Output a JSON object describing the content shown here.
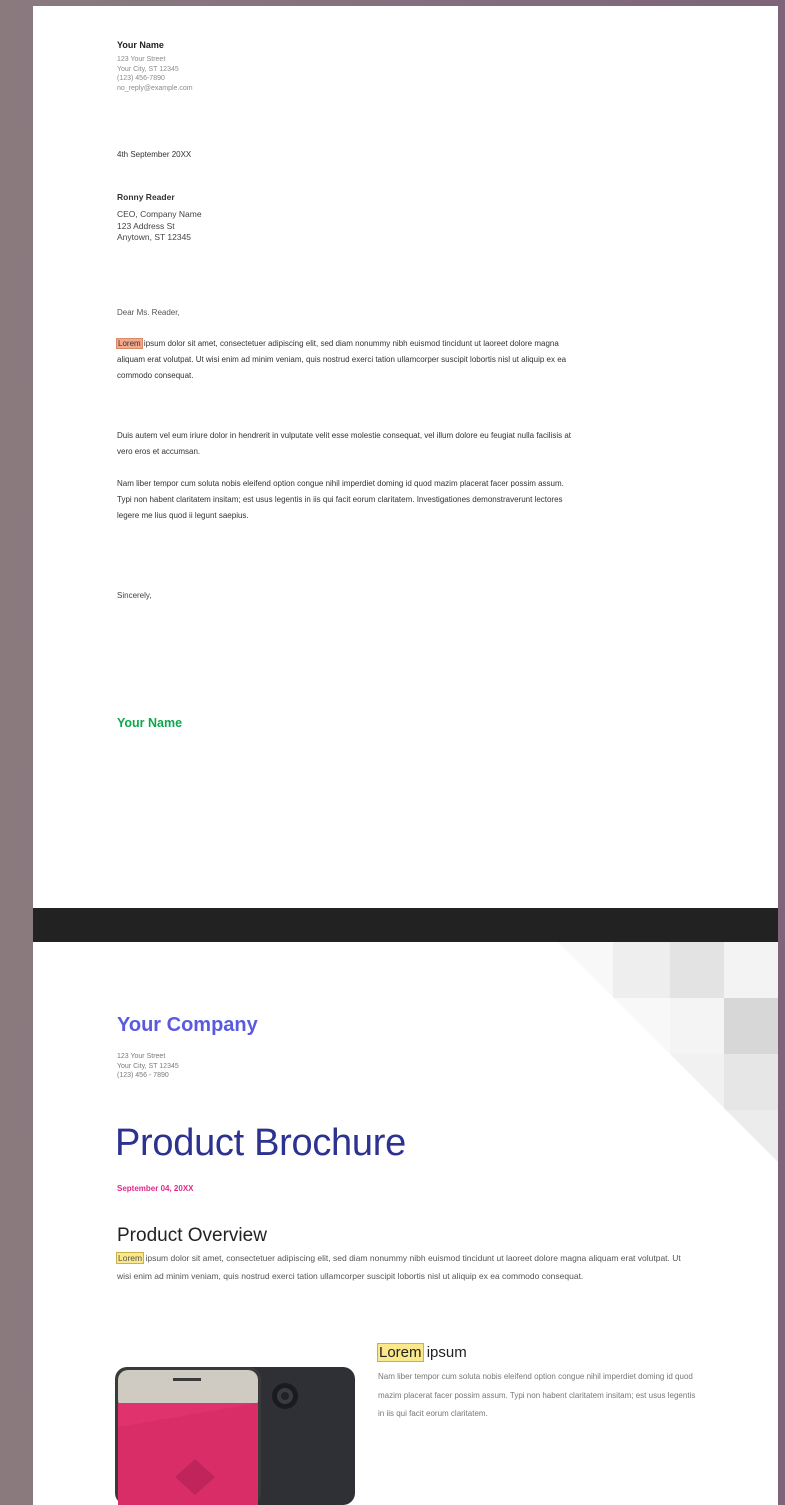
{
  "letter": {
    "sender_name": "Your Name",
    "sender_lines": [
      "123 Your Street",
      "Your City, ST 12345",
      "(123) 456-7890",
      "no_reply@example.com"
    ],
    "date": "4th September 20XX",
    "recipient_name": "Ronny Reader",
    "recipient_lines": [
      "CEO, Company Name",
      "123 Address St",
      "Anytown, ST 12345"
    ],
    "salutation": "Dear Ms. Reader,",
    "para1_highlight": "Lorem",
    "para1_rest": " ipsum dolor sit amet, consectetuer adipiscing elit, sed diam nonummy nibh euismod tincidunt ut laoreet dolore magna aliquam erat volutpat. Ut wisi enim ad minim veniam, quis nostrud exerci tation ullamcorper suscipit lobortis nisl ut aliquip ex ea commodo consequat.",
    "para2": "Duis autem vel eum iriure dolor in hendrerit in vulputate velit esse molestie consequat, vel illum dolore eu feugiat nulla facilisis at vero eros et accumsan.",
    "para3": "Nam liber tempor cum soluta nobis eleifend option congue nihil imperdiet doming id quod mazim placerat facer possim assum. Typi non habent claritatem insitam; est usus legentis in iis qui facit eorum claritatem. Investigationes demonstraverunt lectores legere me lius quod ii legunt saepius.",
    "closing": "Sincerely,",
    "signature": "Your Name"
  },
  "brochure": {
    "company": "Your Company",
    "company_lines": [
      "123 Your Street",
      "Your City, ST 12345",
      "(123) 456 - 7890"
    ],
    "title": "Product Brochure",
    "date": "September 04, 20XX",
    "overview_heading": "Product Overview",
    "overview_highlight": "Lorem",
    "overview_rest": " ipsum dolor sit amet, consectetuer adipiscing elit, sed diam nonummy nibh euismod tincidunt ut laoreet dolore magna aliquam erat volutpat. Ut wisi enim ad minim veniam, quis nostrud exerci tation ullamcorper suscipit lobortis nisl ut aliquip ex ea commodo consequat.",
    "sub_highlight": "Lorem",
    "sub_rest": " ipsum",
    "sub_text": "Nam liber tempor cum soluta nobis eleifend option congue nihil imperdiet doming id quod mazim placerat facer possim assum. Typi non habent claritatem insitam; est usus legentis in iis qui facit eorum claritatem."
  },
  "colors": {
    "signature": "#0ea84c",
    "company": "#5a5ae0",
    "title": "#2d3190",
    "date_accent": "#e22a8c",
    "highlight_letter": "#f4a98c",
    "highlight_brochure": "#fbe88a"
  }
}
